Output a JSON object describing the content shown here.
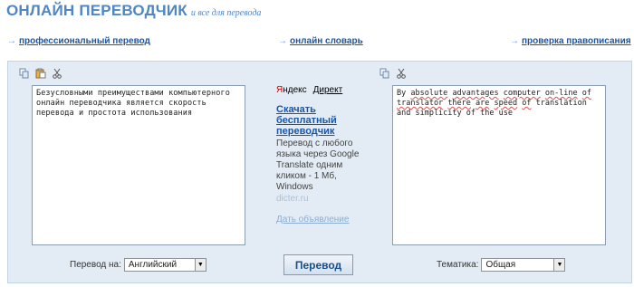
{
  "header": {
    "title": "ОНЛАЙН ПЕРЕВОДЧИК",
    "tagline": "и все для перевода"
  },
  "nav": {
    "professional": "профессиональный перевод",
    "dictionary": "онлайн словарь",
    "spellcheck": "проверка правописания"
  },
  "source": {
    "text": "Безусловными преимуществами компьютерного онлайн переводчика является скорость перевода и простота использования",
    "icons": [
      "copy-icon",
      "paste-icon",
      "cut-icon"
    ]
  },
  "result": {
    "text_parts": [
      {
        "t": "By ",
        "err": false
      },
      {
        "t": "absolute",
        "err": true
      },
      {
        "t": " ",
        "err": false
      },
      {
        "t": "advantages",
        "err": true
      },
      {
        "t": " ",
        "err": false
      },
      {
        "t": "computer",
        "err": true
      },
      {
        "t": " ",
        "err": false
      },
      {
        "t": "on-line",
        "err": true
      },
      {
        "t": " ",
        "err": false
      },
      {
        "t": "of",
        "err": true
      },
      {
        "t": " ",
        "err": false
      },
      {
        "t": "translator",
        "err": true
      },
      {
        "t": " ",
        "err": false
      },
      {
        "t": "there",
        "err": true
      },
      {
        "t": " ",
        "err": false
      },
      {
        "t": "are",
        "err": true
      },
      {
        "t": " ",
        "err": false
      },
      {
        "t": "speed",
        "err": true
      },
      {
        "t": " ",
        "err": false
      },
      {
        "t": "of",
        "err": true
      },
      {
        "t": " translation and simplicity of the use",
        "err": false
      }
    ],
    "icons": [
      "copy-icon",
      "cut-icon"
    ]
  },
  "ad": {
    "brand_yandex": "Яндекс",
    "brand_direct": "Директ",
    "title": "Скачать бесплатный переводчик",
    "description": "Перевод с любого языка через Google Translate одним кликом - 1 Мб, Windows",
    "domain": "dicter.ru",
    "post_ad": "Дать объявление"
  },
  "controls": {
    "translate_to_label": "Перевод на:",
    "translate_to_value": "Английский",
    "translate_button": "Перевод",
    "topic_label": "Тематика:",
    "topic_value": "Общая"
  },
  "colors": {
    "accent": "#4f86c6",
    "link": "#1a55a6",
    "panel": "#e3ecf5"
  }
}
